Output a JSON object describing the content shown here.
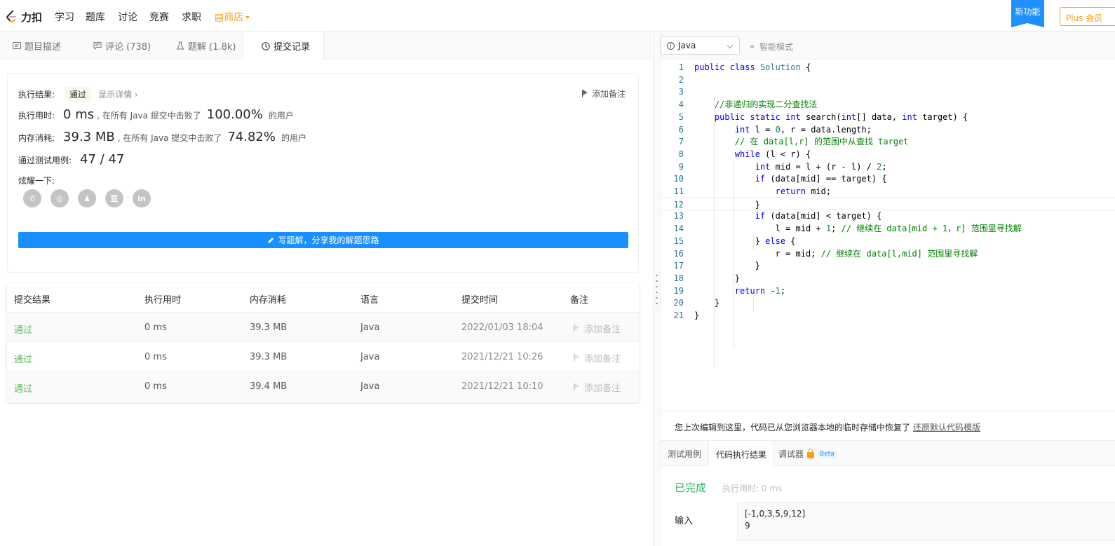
{
  "nav": {
    "logo_text": "力扣",
    "items": [
      "学习",
      "题库",
      "讨论",
      "竞赛",
      "求职"
    ],
    "shop": "商店",
    "new_feature": "新功能",
    "plus": "Plus 会员"
  },
  "left_tabs": [
    {
      "label": "题目描述",
      "icon": "description-icon"
    },
    {
      "label": "评论 (738)",
      "icon": "comment-icon"
    },
    {
      "label": "题解 (1.8k)",
      "icon": "flask-icon"
    },
    {
      "label": "提交记录",
      "icon": "clock-icon"
    }
  ],
  "result": {
    "exec_label": "执行结果:",
    "status": "通过",
    "details": "显示详情 ›",
    "add_note": "添加备注",
    "time_label": "执行用时:",
    "time_value": "0 ms",
    "time_mid": ", 在所有 Java 提交中击败了",
    "time_pct": "100.00%",
    "users": "的用户",
    "mem_label": "内存消耗:",
    "mem_value": "39.3 MB",
    "mem_mid": ", 在所有 Java 提交中击败了",
    "mem_pct": "74.82%",
    "tests_label": "通过测试用例:",
    "tests_value": "47 / 47",
    "share_label": "炫耀一下:",
    "shares": [
      "wechat-icon",
      "weibo-icon",
      "qq-icon",
      "douban-icon",
      "linkedin-icon"
    ],
    "share_glyphs": [
      "✆",
      "◎",
      "♟",
      "豆",
      "in"
    ],
    "write_btn": "写题解，分享我的解题思路"
  },
  "table": {
    "headers": [
      "提交结果",
      "执行用时",
      "内存消耗",
      "语言",
      "提交时间",
      "备注"
    ],
    "rows": [
      {
        "result": "通过",
        "time": "0 ms",
        "mem": "39.3 MB",
        "lang": "Java",
        "date": "2022/01/03 18:04",
        "note": "添加备注"
      },
      {
        "result": "通过",
        "time": "0 ms",
        "mem": "39.3 MB",
        "lang": "Java",
        "date": "2021/12/21 10:26",
        "note": "添加备注"
      },
      {
        "result": "通过",
        "time": "0 ms",
        "mem": "39.4 MB",
        "lang": "Java",
        "date": "2021/12/21 10:10",
        "note": "添加备注"
      }
    ]
  },
  "editor": {
    "language": "Java",
    "smart_mode": "智能模式",
    "lines": [
      "public class Solution {",
      "",
      "",
      "    //非递归的实现二分查找法",
      "    public static int search(int[] data, int target) {",
      "        int l = 0, r = data.length;",
      "        // 在 data[l,r] 的范围中从查找 target",
      "        while (l < r) {",
      "            int mid = l + (r - l) / 2;",
      "            if (data[mid] == target) {",
      "                return mid;",
      "            }",
      "            if (data[mid] < target) {",
      "                l = mid + 1; // 继续在 data[mid + 1，r] 范围里寻找解",
      "            } else {",
      "                r = mid; // 继续在 data[l,mid] 范围里寻找解",
      "            }",
      "        }",
      "        return -1;",
      "    }",
      "}"
    ]
  },
  "restore": {
    "text": "您上次编辑到这里，代码已从您浏览器本地的临时存储中恢复了",
    "link": "还原默认代码模版"
  },
  "bottom_tabs": [
    "测试用例",
    "代码执行结果",
    "调试器"
  ],
  "beta": "Beta",
  "run": {
    "status": "已完成",
    "runtime": "执行用时: 0 ms",
    "input_label": "输入",
    "input_lines": [
      "[-1,0,3,5,9,12]",
      "9"
    ]
  }
}
